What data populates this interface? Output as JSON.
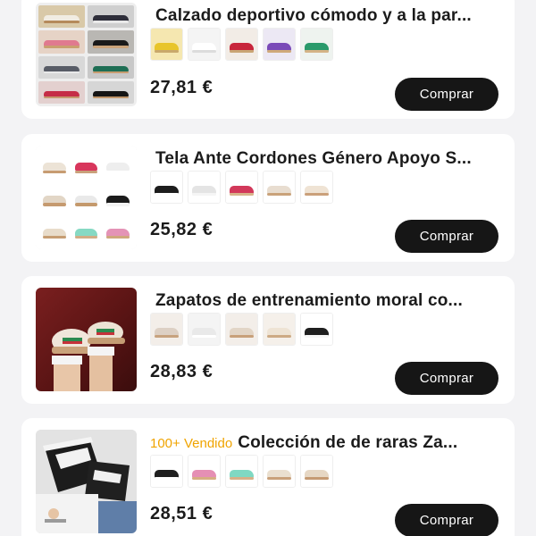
{
  "products": [
    {
      "title": "Calzado deportivo cómodo y a la par...",
      "badge": "",
      "price": "27,81 €",
      "buy_label": "Comprar",
      "thumb_icon": "sneaker-collage-image",
      "swatch_colors": [
        {
          "bg": "#f5e7b0",
          "shoe": "#e8c52a",
          "sole": "#c9a86b"
        },
        {
          "bg": "#f4f4f4",
          "shoe": "#ffffff",
          "sole": "#dcdcdc"
        },
        {
          "bg": "#f2ece6",
          "shoe": "#c8253b",
          "sole": "#c9a574"
        },
        {
          "bg": "#ece8f4",
          "shoe": "#7a4ab8",
          "sole": "#cfa97a"
        },
        {
          "bg": "#eef3ef",
          "shoe": "#2a9a6b",
          "sole": "#d4b386"
        }
      ]
    },
    {
      "title": "Tela Ante Cordones Género Apoyo S...",
      "badge": "",
      "price": "25,82 €",
      "buy_label": "Comprar",
      "thumb_icon": "sneaker-grid-image",
      "swatch_colors": [
        {
          "bg": "#ffffff",
          "shoe": "#1d1d1d",
          "sole": "#ffffff"
        },
        {
          "bg": "#ffffff",
          "shoe": "#e4e4e4",
          "sole": "#f5f5f5"
        },
        {
          "bg": "#ffffff",
          "shoe": "#d2385a",
          "sole": "#d8b48a"
        },
        {
          "bg": "#ffffff",
          "shoe": "#e8ddd0",
          "sole": "#c9a27a"
        },
        {
          "bg": "#ffffff",
          "shoe": "#efe3d4",
          "sole": "#caa07a"
        }
      ]
    },
    {
      "title": "Zapatos de entrenamiento moral co...",
      "badge": "",
      "price": "28,83 €",
      "buy_label": "Comprar",
      "thumb_icon": "sneaker-worn-photo",
      "swatch_colors": [
        {
          "bg": "#f3eee9",
          "shoe": "#ddd0c4",
          "sole": "#c7a27e"
        },
        {
          "bg": "#f4f4f4",
          "shoe": "#e9e9e9",
          "sole": "#ffffff"
        },
        {
          "bg": "#f3eee9",
          "shoe": "#e2d5c6",
          "sole": "#c8a07a"
        },
        {
          "bg": "#f5f0ea",
          "shoe": "#eee3d4",
          "sole": "#cdaa84"
        },
        {
          "bg": "#ffffff",
          "shoe": "#1f1f1f",
          "sole": "#f7f7f7"
        }
      ]
    },
    {
      "title": "Colección de de raras Za...",
      "badge": "100+ Vendido",
      "price": "28,51 €",
      "buy_label": "Comprar",
      "thumb_icon": "sneaker-on-feet-photo",
      "swatch_colors": [
        {
          "bg": "#ffffff",
          "shoe": "#1f1f1f",
          "sole": "#ffffff"
        },
        {
          "bg": "#ffffff",
          "shoe": "#e58fb4",
          "sole": "#d6ae82"
        },
        {
          "bg": "#ffffff",
          "shoe": "#7fd8c2",
          "sole": "#d6b088"
        },
        {
          "bg": "#ffffff",
          "shoe": "#eadfcf",
          "sole": "#c9a07a"
        },
        {
          "bg": "#ffffff",
          "shoe": "#e6d7c4",
          "sole": "#c59a73"
        }
      ]
    }
  ]
}
